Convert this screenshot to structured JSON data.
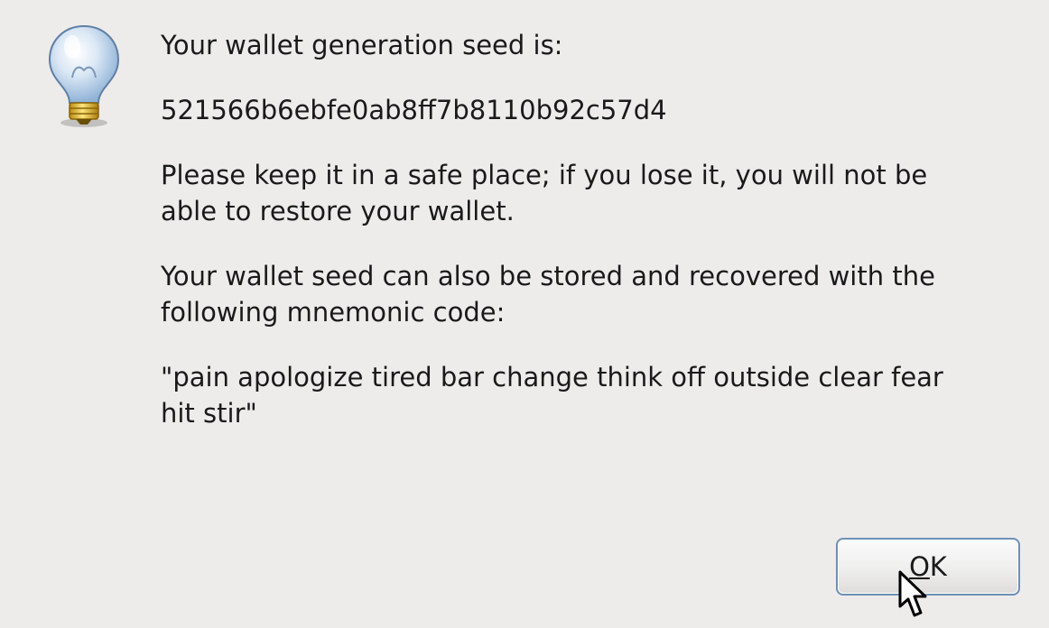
{
  "dialog": {
    "icon": "lightbulb-icon",
    "heading": "Your wallet generation seed is:",
    "seed": "521566b6ebfe0ab8ff7b8110b92c57d4",
    "warning_line1": "Please keep it in a safe place; if you lose it, you will not be",
    "warning_line2": "able to restore your wallet.",
    "mnemonic_intro_line1": "Your wallet seed can also be stored and recovered with the",
    "mnemonic_intro_line2": "following mnemonic code:",
    "mnemonic_line1": "\"pain apologize tired bar change think off outside clear fear",
    "mnemonic_line2": "hit stir\""
  },
  "buttons": {
    "ok_mnemonic": "O",
    "ok_rest": "K"
  },
  "colors": {
    "background": "#edeceb",
    "button_border": "#6f8fb4",
    "text": "#1a1a1a"
  },
  "cursor": "arrow-pointer-icon"
}
